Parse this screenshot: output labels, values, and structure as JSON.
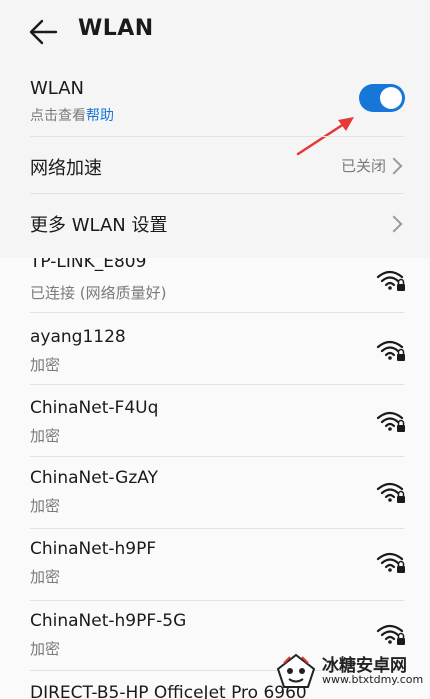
{
  "header": {
    "title": "WLAN"
  },
  "wlan_row": {
    "label": "WLAN",
    "hint_prefix": "点击查看",
    "hint_link": "帮助",
    "toggle_on": true
  },
  "accel_row": {
    "label": "网络加速",
    "value": "已关闭"
  },
  "more_row": {
    "label": "更多 WLAN 设置"
  },
  "networks": [
    {
      "name": "TP-LINK_E809",
      "status": "已连接 (网络质量好)"
    },
    {
      "name": "ayang1128",
      "status": "加密"
    },
    {
      "name": "ChinaNet-F4Uq",
      "status": "加密"
    },
    {
      "name": "ChinaNet-GzAY",
      "status": "加密"
    },
    {
      "name": "ChinaNet-h9PF",
      "status": "加密"
    },
    {
      "name": "ChinaNet-h9PF-5G",
      "status": "加密"
    },
    {
      "name": "DIRECT-B5-HP OfficeJet Pro 6960",
      "status": ""
    }
  ],
  "watermark": {
    "title": "冰糖安卓网",
    "url": "www.btxtdmy.com"
  },
  "colors": {
    "accent": "#1677d9",
    "annotation": "#e53935"
  }
}
